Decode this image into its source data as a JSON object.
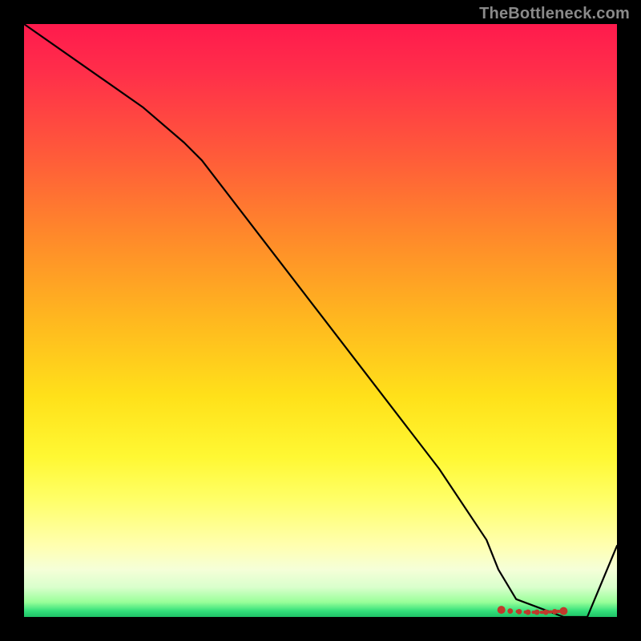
{
  "watermark": "TheBottleneck.com",
  "chart_data": {
    "type": "line",
    "title": "",
    "xlabel": "",
    "ylabel": "",
    "xlim": [
      0,
      100
    ],
    "ylim": [
      0,
      100
    ],
    "grid": false,
    "legend": false,
    "series": [
      {
        "name": "curve",
        "color": "#000000",
        "x": [
          0,
          10,
          20,
          27,
          30,
          40,
          50,
          60,
          70,
          78,
          80,
          83,
          91,
          95,
          100
        ],
        "values": [
          100,
          93,
          86,
          80,
          77,
          64,
          51,
          38,
          25,
          13,
          8,
          3,
          0,
          0,
          12
        ]
      }
    ],
    "markers": {
      "name": "bottom-dotted-segment",
      "color": "#c0392b",
      "x": [
        80.5,
        82.0,
        83.5,
        85.0,
        86.5,
        88.0,
        89.5,
        91.0
      ],
      "values": [
        1.2,
        1.0,
        0.9,
        0.8,
        0.8,
        0.8,
        0.9,
        1.0
      ]
    },
    "gradient_stops": [
      {
        "pos": 0,
        "color": "#ff1a4d"
      },
      {
        "pos": 0.08,
        "color": "#ff2e4a"
      },
      {
        "pos": 0.22,
        "color": "#ff5a3a"
      },
      {
        "pos": 0.36,
        "color": "#ff8a2a"
      },
      {
        "pos": 0.5,
        "color": "#ffb81f"
      },
      {
        "pos": 0.63,
        "color": "#ffe11a"
      },
      {
        "pos": 0.73,
        "color": "#fff833"
      },
      {
        "pos": 0.8,
        "color": "#ffff66"
      },
      {
        "pos": 0.88,
        "color": "#ffffb0"
      },
      {
        "pos": 0.92,
        "color": "#f5ffd8"
      },
      {
        "pos": 0.95,
        "color": "#d9ffcc"
      },
      {
        "pos": 0.975,
        "color": "#99ff99"
      },
      {
        "pos": 0.99,
        "color": "#33e07a"
      },
      {
        "pos": 1.0,
        "color": "#1fc266"
      }
    ]
  }
}
